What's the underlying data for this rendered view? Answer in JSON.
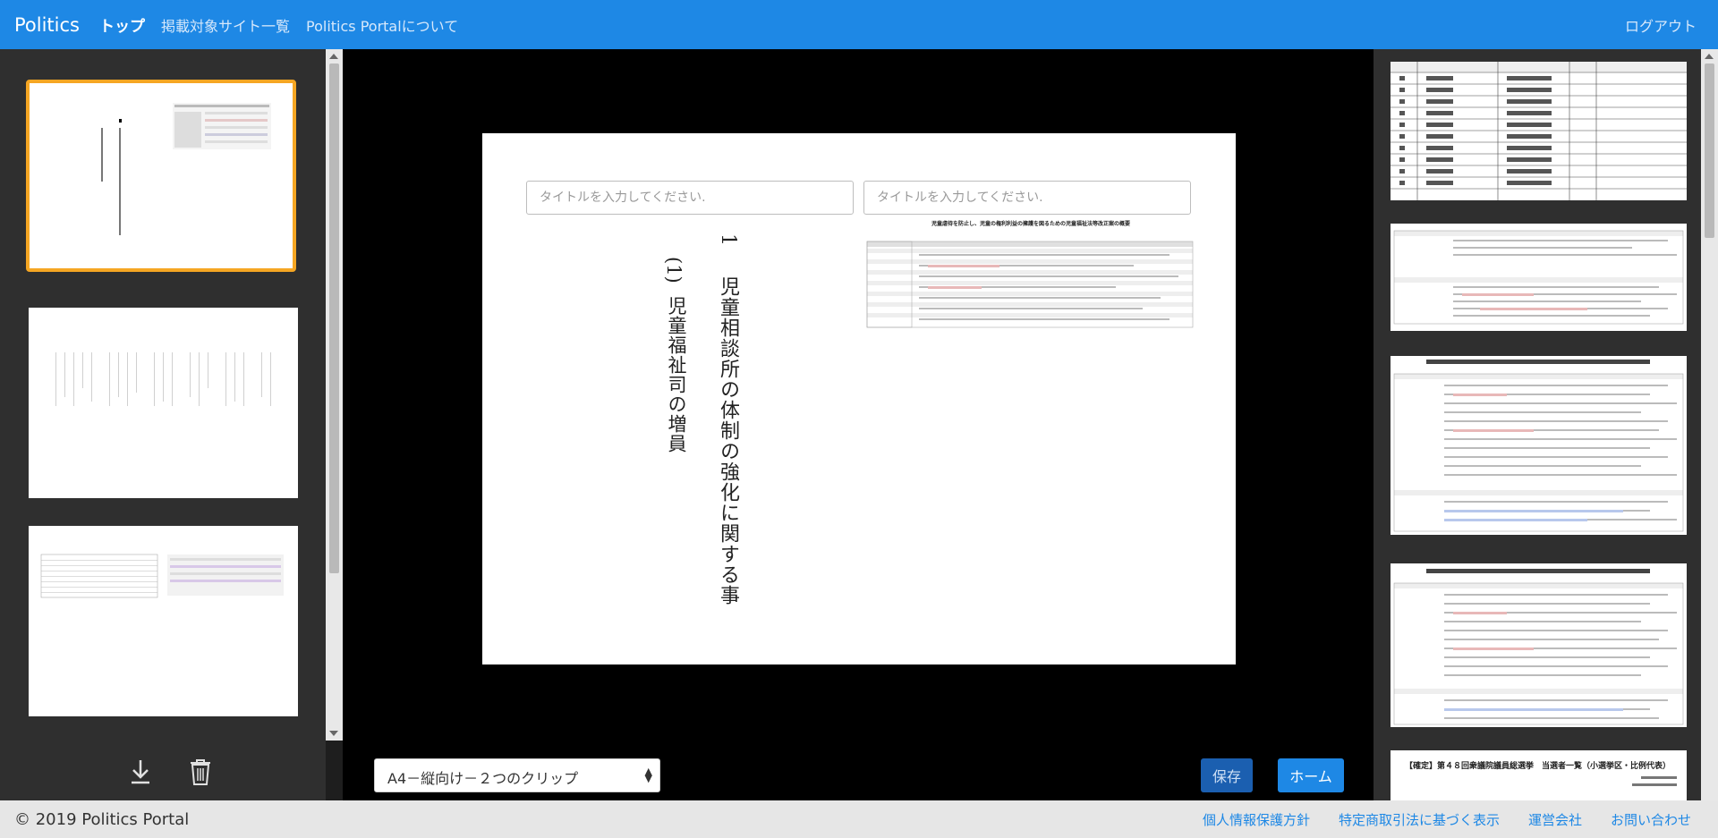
{
  "header": {
    "brand": "Politics",
    "nav": [
      "トップ",
      "掲載対象サイト一覧",
      "Politics Portalについて"
    ],
    "logout": "ログアウト"
  },
  "editor": {
    "title_placeholder_left": "タイトルを入力してください.",
    "title_placeholder_right": "タイトルを入力してください.",
    "page_number": "1",
    "heading": "児童相談所の体制の強化に関する事",
    "subheading_num": "(1)",
    "subheading": "児童福祉司の増員",
    "doc_title": "児童虐待を防止し、児童の権利利益の擁護を図るための児童福祉法等改正案の概要",
    "layout_option": "A4－縦向け－２つのクリップ",
    "save_label": "保存",
    "home_label": "ホーム"
  },
  "right_panel": {
    "election_title": "【確定】第４８回衆議院議員総選挙　当選者一覧（小選挙区・比例代表）"
  },
  "footer": {
    "copyright": "© 2019 Politics Portal",
    "links": [
      "個人情報保護方針",
      "特定商取引法に基づく表示",
      "運営会社",
      "お問い合わせ"
    ]
  },
  "colors": {
    "header": "#1e88e5",
    "selected_border": "#f5a623",
    "save_button": "#1b5fb0",
    "home_button": "#1e88e5"
  }
}
